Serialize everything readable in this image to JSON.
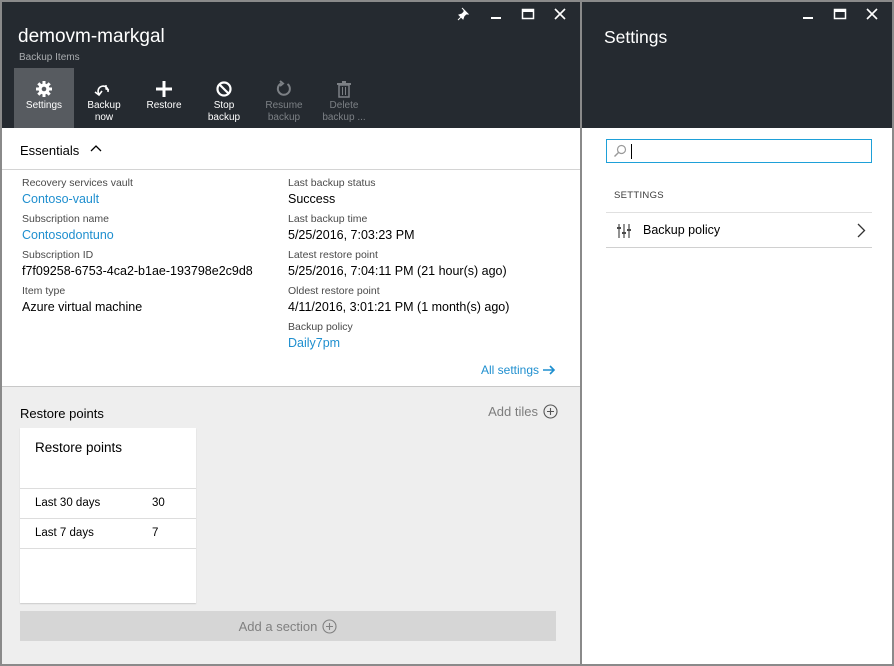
{
  "left_blade": {
    "title": "demovm-markgal",
    "subtitle": "Backup Items",
    "toolbar": [
      {
        "label": "Settings",
        "icon": "gear-icon",
        "active": true,
        "disabled": false
      },
      {
        "label": "Backup\nnow",
        "icon": "backup-now-icon",
        "active": false,
        "disabled": false
      },
      {
        "label": "Restore",
        "icon": "plus-icon",
        "active": false,
        "disabled": false
      },
      {
        "label": "Stop\nbackup",
        "icon": "stop-icon",
        "active": false,
        "disabled": false
      },
      {
        "label": "Resume\nbackup",
        "icon": "resume-icon",
        "active": false,
        "disabled": true
      },
      {
        "label": "Delete\nbackup ...",
        "icon": "trash-icon",
        "active": false,
        "disabled": true
      }
    ],
    "essentials": {
      "title": "Essentials",
      "col1": [
        {
          "label": "Recovery services vault",
          "value": "Contoso-vault",
          "link": true
        },
        {
          "label": "Subscription name",
          "value": "Contosodontuno",
          "link": true
        },
        {
          "label": "Subscription ID",
          "value": "f7f09258-6753-4ca2-b1ae-193798e2c9d8",
          "link": false
        },
        {
          "label": "Item type",
          "value": "Azure virtual machine",
          "link": false
        }
      ],
      "col2": [
        {
          "label": "Last backup status",
          "value": "Success",
          "link": false
        },
        {
          "label": "Last backup time",
          "value": "5/25/2016, 7:03:23 PM",
          "link": false
        },
        {
          "label": "Latest restore point",
          "value": "5/25/2016, 7:04:11 PM (21 hour(s) ago)",
          "link": false
        },
        {
          "label": "Oldest restore point",
          "value": "4/11/2016, 3:01:21 PM (1 month(s) ago)",
          "link": false
        },
        {
          "label": "Backup policy",
          "value": "Daily7pm",
          "link": true
        }
      ],
      "all_settings": "All settings"
    },
    "restore_points": {
      "section_title": "Restore points",
      "add_tiles": "Add tiles",
      "tile_title": "Restore points",
      "rows": [
        {
          "label": "Last 30 days",
          "value": "30"
        },
        {
          "label": "Last 7 days",
          "value": "7"
        }
      ],
      "add_section": "Add a section"
    }
  },
  "right_blade": {
    "title": "Settings",
    "search": {
      "value": "",
      "placeholder": ""
    },
    "section_label": "SETTINGS",
    "items": [
      {
        "label": "Backup policy",
        "icon": "policy-sliders-icon"
      }
    ]
  },
  "colors": {
    "header_bg": "#252a30",
    "link": "#1f8fcf",
    "active_tool": "#575b60",
    "grey_area": "#eeeeee"
  }
}
